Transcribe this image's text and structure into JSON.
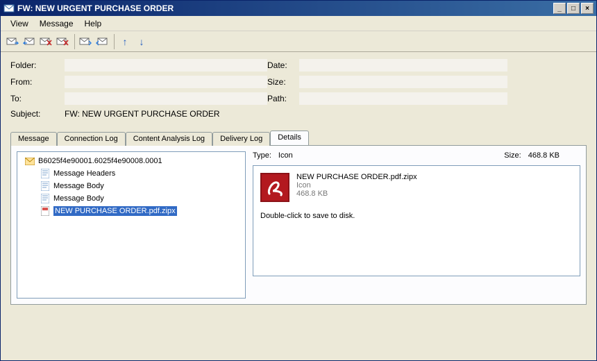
{
  "window": {
    "title": "FW: NEW URGENT PURCHASE ORDER"
  },
  "menu": {
    "view": "View",
    "message": "Message",
    "help": "Help"
  },
  "toolbar_icons": {
    "mailforward": "mail-forward",
    "mailreply": "mail-reply",
    "maildelete": "mail-delete",
    "maildelete2": "mail-delete-2",
    "mailin": "mail-in",
    "mailout": "mail-out",
    "up": "↑",
    "down": "↓"
  },
  "headers": {
    "folder_label": "Folder:",
    "folder_value": "",
    "from_label": "From:",
    "from_value": "",
    "to_label": "To:",
    "to_value": "",
    "subject_label": "Subject:",
    "subject_value": "FW: NEW URGENT PURCHASE ORDER",
    "date_label": "Date:",
    "date_value": "",
    "size_label": "Size:",
    "size_value": "",
    "path_label": "Path:",
    "path_value": ""
  },
  "tabs": {
    "message": "Message",
    "connection": "Connection Log",
    "content": "Content Analysis Log",
    "delivery": "Delivery Log",
    "details": "Details"
  },
  "tree": {
    "root": "B6025f4e90001.6025f4e90008.0001",
    "headers": "Message Headers",
    "body1": "Message Body",
    "body2": "Message Body",
    "attachment": "NEW PURCHASE ORDER.pdf.zipx"
  },
  "detail": {
    "type_label": "Type:",
    "type_value": "Icon",
    "size_label": "Size:",
    "size_value": "468.8 KB",
    "fname": "NEW PURCHASE ORDER.pdf.zipx",
    "fkind": "Icon",
    "fsize": "468.8 KB",
    "hint": "Double-click to save to disk."
  }
}
